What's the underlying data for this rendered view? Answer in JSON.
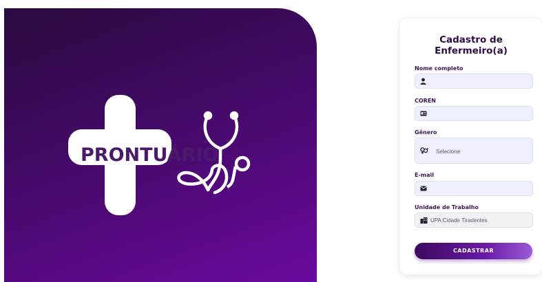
{
  "brand": {
    "logo_text": "PRONTUÁRIO"
  },
  "form": {
    "title_line1": "Cadastro de",
    "title_line2": "Enfermeiro(a)",
    "fields": [
      {
        "label": "Nome completo",
        "icon": "person-icon",
        "value": ""
      },
      {
        "label": "COREN",
        "icon": "id-card-icon",
        "value": ""
      },
      {
        "label": "Gênero",
        "icon": "gender-icon",
        "value": "Selecione"
      },
      {
        "label": "E-mail",
        "icon": "envelope-icon",
        "value": ""
      },
      {
        "label": "Unidade de Trabalho",
        "icon": "building-icon",
        "value": "UPA Cidade Tiradentes"
      }
    ],
    "submit_label": "CADASTRAR"
  },
  "colors": {
    "brand_dark": "#2a0b3e",
    "brand_light": "#6a0aa0",
    "field_bg": "#eef0fd",
    "title": "#2b0f45"
  }
}
